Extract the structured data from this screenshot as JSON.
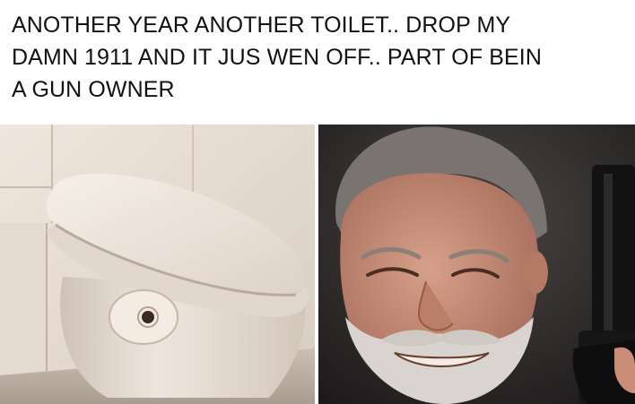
{
  "caption": {
    "lines": [
      "ANOTHER YEAR ANOTHER TOILET.. DROP MY",
      "DAMN 1911 AND IT JUS WEN OFF.. PART OF BEIN",
      "A GUN OWNER"
    ]
  },
  "images": {
    "left": "toilet-with-bullet-hole-photo",
    "right": "smiling-man-holding-pistol-photo"
  },
  "colors": {
    "text": "#111111",
    "background": "#ffffff",
    "toilet": "#ece4dc",
    "wall": "#e7ddd3",
    "right_bg": "#262424",
    "beard": "#d9d4cf",
    "skin": "#c98d78"
  }
}
